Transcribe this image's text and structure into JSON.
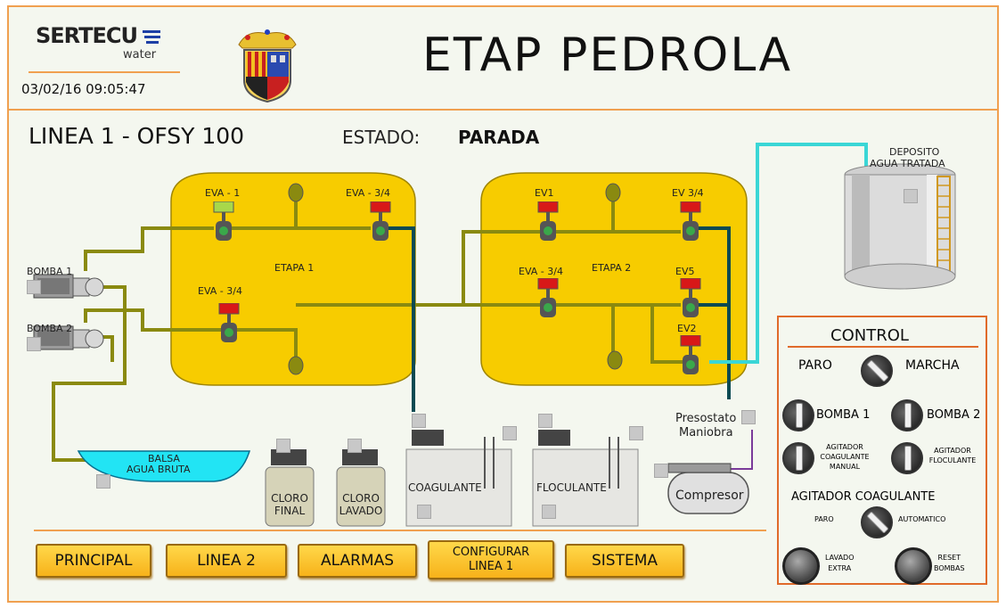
{
  "header": {
    "logo": "SERTECU",
    "logo_sub": "water",
    "datetime": "03/02/16 09:05:47",
    "title": "ETAP PEDROLA"
  },
  "line": {
    "name": "LINEA 1 - OFSY 100",
    "state_label": "ESTADO:",
    "state_value": "PARADA"
  },
  "stage1": {
    "label": "ETAPA 1",
    "valves": [
      "EVA - 1",
      "EVA - 3/4",
      "EVA - 3/4"
    ]
  },
  "stage2": {
    "label": "ETAPA 2",
    "valves": [
      "EV1",
      "EV 3/4",
      "EVA - 3/4",
      "EV5",
      "EV2"
    ]
  },
  "pumps": [
    "BOMBA 1",
    "BOMBA 2"
  ],
  "raw_pond": {
    "line1": "BALSA",
    "line2": "AGUA BRUTA"
  },
  "treated_tank": {
    "line1": "DEPOSITO",
    "line2": "AGUA TRATADA"
  },
  "dosing": {
    "cloro_final": [
      "CLORO",
      "FINAL"
    ],
    "cloro_lavado": [
      "CLORO",
      "LAVADO"
    ],
    "coagulante": "COAGULANTE",
    "floculante": "FLOCULANTE"
  },
  "pressostat": {
    "line1": "Presostato",
    "line2": "Maniobra"
  },
  "compressor": "Compresor",
  "control": {
    "title": "CONTROL",
    "paro": "PARO",
    "marcha": "MARCHA",
    "bomba1": "BOMBA 1",
    "bomba2": "BOMBA 2",
    "agit_coag_manual": [
      "AGITADOR",
      "COAGULANTE",
      "MANUAL"
    ],
    "agit_floc": [
      "AGITADOR",
      "FLOCULANTE"
    ],
    "agit_coag_title": "AGITADOR COAGULANTE",
    "paro_small": "PARO",
    "automatico": "AUTOMATICO",
    "lavado_extra": [
      "LAVADO",
      "EXTRA"
    ],
    "reset_bombas": [
      "RESET",
      "BOMBAS"
    ]
  },
  "nav": {
    "principal": "PRINCIPAL",
    "linea2": "LINEA 2",
    "alarmas": "ALARMAS",
    "configurar_1": "CONFIGURAR",
    "configurar_2": "LINEA 1",
    "sistema": "SISTEMA"
  },
  "colors": {
    "accent_border": "#f0a050",
    "tank_yellow": "#f7cc00",
    "pipe_olive": "#8a8a10",
    "pipe_teal": "#0b4a52",
    "pipe_cyan": "#3ad6d6",
    "valve_red": "#d81818",
    "valve_green": "#a8d84a",
    "button_yellow": "#f7b21a"
  }
}
